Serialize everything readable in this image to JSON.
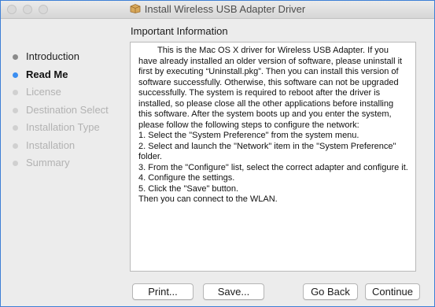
{
  "window": {
    "title": "Install Wireless USB Adapter Driver"
  },
  "sidebar": {
    "items": [
      {
        "label": "Introduction",
        "state": "done"
      },
      {
        "label": "Read Me",
        "state": "current"
      },
      {
        "label": "License",
        "state": "pending"
      },
      {
        "label": "Destination Select",
        "state": "pending"
      },
      {
        "label": "Installation Type",
        "state": "pending"
      },
      {
        "label": "Installation",
        "state": "pending"
      },
      {
        "label": "Summary",
        "state": "pending"
      }
    ]
  },
  "main": {
    "heading": "Important Information",
    "paragraph": "This is the Mac OS X driver for Wireless USB Adapter. If you have already installed an older version of software, please uninstall it first by executing “Uninstall.pkg”. Then you can install this version of software successfully. Otherwise, this software can not be upgraded successfully. The system is required to reboot after the driver is installed, so please close all the other applications before installing this software. After the system boots up and you enter the system, please follow the following steps to configure the network:",
    "steps": [
      "1. Select the \"System Preference\" from the system menu.",
      "2. Select and launch the \"Network\" item in the \"System Preference\" folder.",
      "3. From the \"Configure\" list, select the correct adapter and configure it.",
      "4. Configure the settings.",
      "5. Click the \"Save\" button."
    ],
    "closing": "Then you can connect to the WLAN."
  },
  "buttons": {
    "print": "Print...",
    "save": "Save...",
    "back": "Go Back",
    "continue": "Continue"
  },
  "colors": {
    "accent": "#3b8ef1",
    "border": "#3d7fd6"
  },
  "icons": {
    "title": "package-icon"
  }
}
